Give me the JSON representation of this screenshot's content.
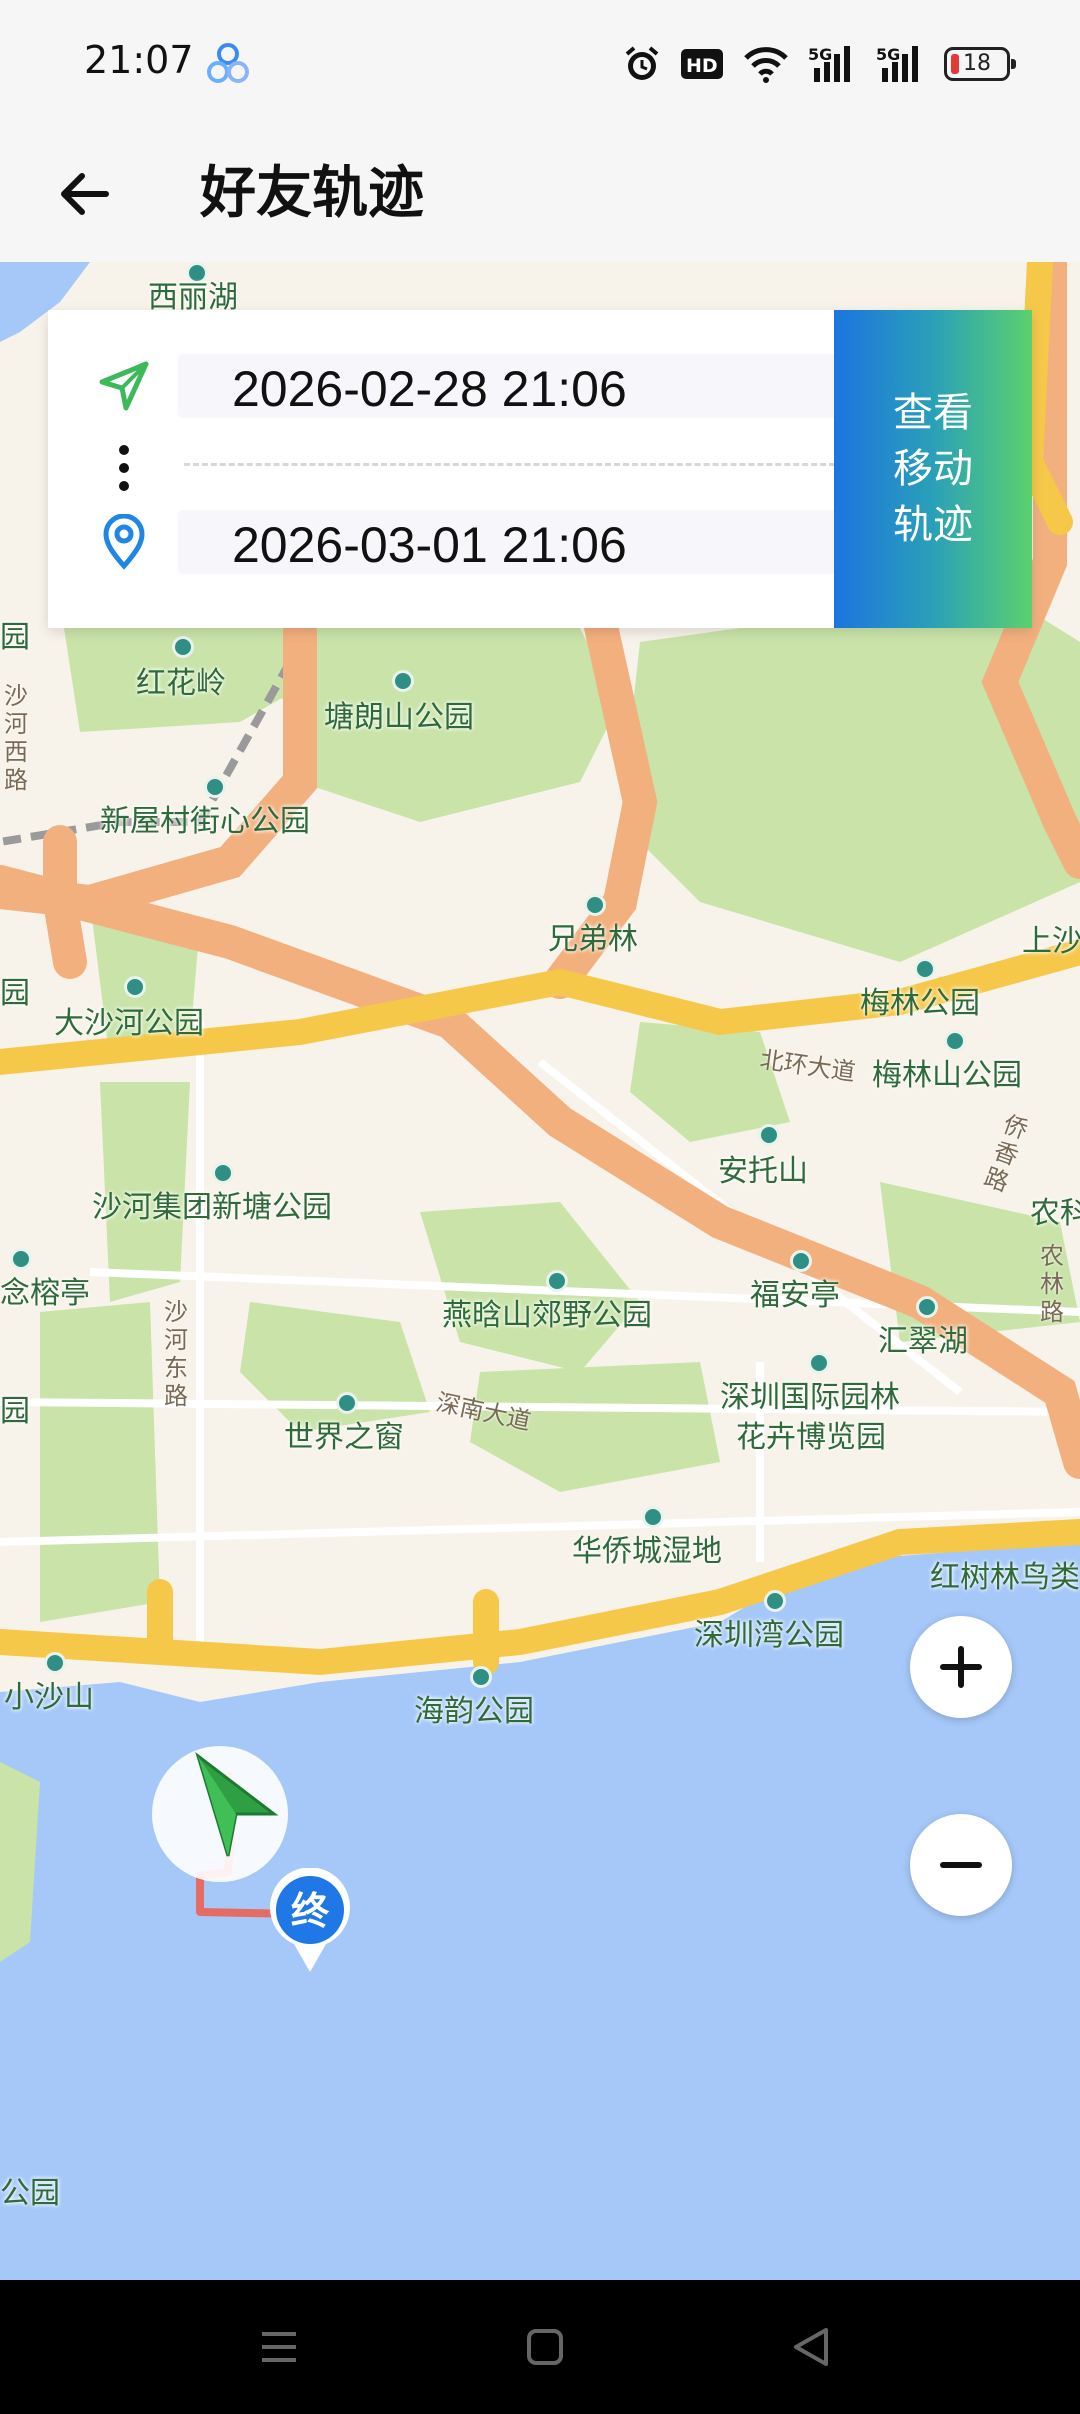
{
  "status_bar": {
    "time": "21:07",
    "battery": "18",
    "icons": [
      "app-logo-icon",
      "alarm-icon",
      "hd-icon",
      "wifi-icon",
      "5g-signal-icon",
      "5g-signal-icon",
      "battery-icon"
    ]
  },
  "header": {
    "title": "好友轨迹",
    "back_icon": "arrow-left-icon"
  },
  "card": {
    "start_time": "2026-02-28 21:06",
    "end_time": "2026-03-01 21:06",
    "view_button": "查看移动轨迹",
    "start_icon": "navigation-arrow-icon",
    "end_icon": "location-pin-icon"
  },
  "map": {
    "poi_labels": [
      "西丽湖",
      "红花岭",
      "塘朗山公园",
      "新屋村街心公园",
      "兄弟林",
      "大沙河公园",
      "梅林公园",
      "梅林山公园",
      "安托山",
      "沙河集团新塘公园",
      "燕晗山郊野公园",
      "福安亭",
      "汇翠湖",
      "念榕亭",
      "世界之窗",
      "深圳国际园林",
      "花卉博览园",
      "华侨城湿地",
      "红树林鸟类",
      "深圳湾公园",
      "小沙山",
      "海韵公园",
      "上沙",
      "农科",
      "公园",
      "园",
      "园",
      "园"
    ],
    "road_labels": [
      "北环大道",
      "深南大道",
      "沙河西路",
      "沙河东路",
      "侨香路",
      "农林路"
    ],
    "end_marker_label": "终",
    "colors": {
      "water": "#a6c8f8",
      "green": "#c9e3a9",
      "expressway": "#f2b07e",
      "arterial": "#f6c84a",
      "land": "#f7f3ea",
      "track": "#f05a4a"
    }
  },
  "zoom": {
    "in": "+",
    "out": "−"
  },
  "nav_bar": {
    "icons": [
      "menu-icon",
      "home-icon",
      "back-triangle-icon"
    ]
  }
}
